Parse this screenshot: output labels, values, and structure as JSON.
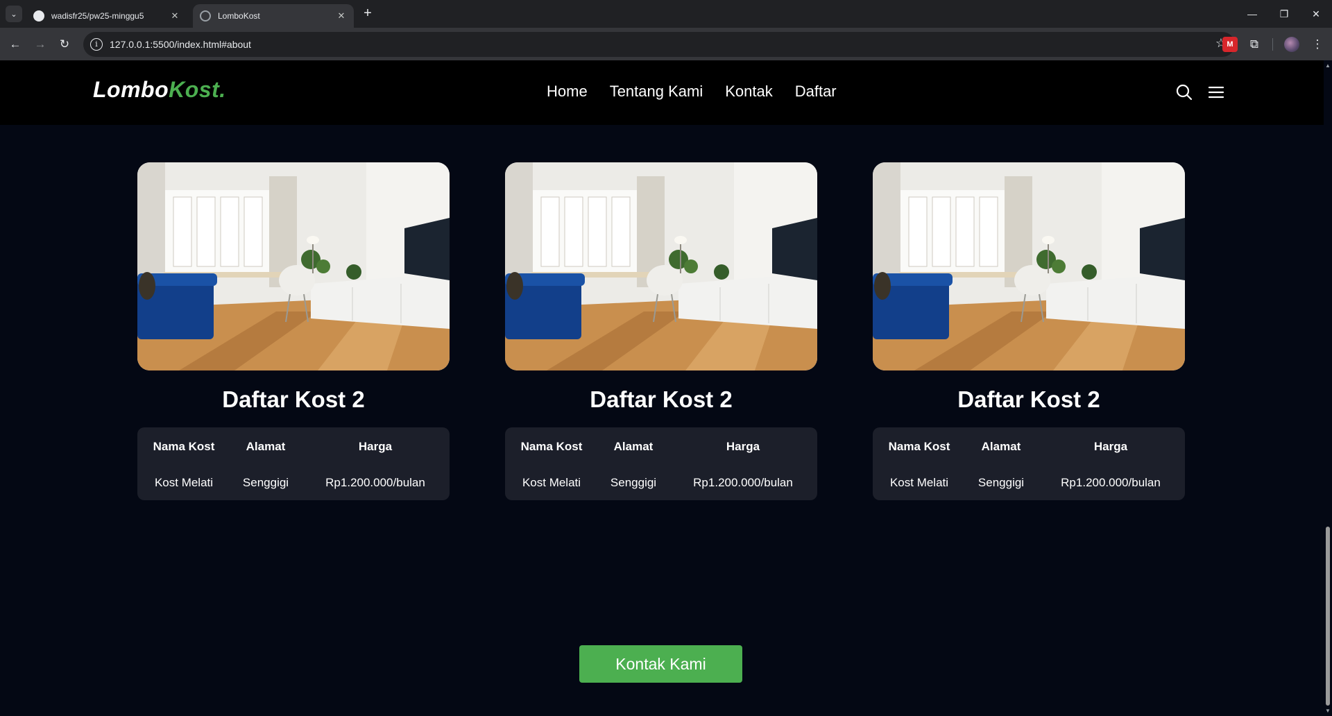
{
  "browser": {
    "tabs": [
      {
        "title": "wadisfr25/pw25-minggu5",
        "close": "✕"
      },
      {
        "title": "LomboKost",
        "close": "✕"
      }
    ],
    "new_tab": "+",
    "url": "127.0.0.1:5500/index.html#about",
    "window_controls": {
      "minimize": "—",
      "restore": "❐",
      "close": "✕"
    }
  },
  "site": {
    "logo": {
      "part1": "Lombo",
      "part2": "Kost."
    },
    "menu": [
      "Home",
      "Tentang Kami",
      "Kontak",
      "Daftar"
    ],
    "icons": [
      "search-icon",
      "hamburger-icon"
    ],
    "accent_color": "#4caf50",
    "background_color": "#040814"
  },
  "cards": [
    {
      "title": "Daftar Kost 2",
      "headers": [
        "Nama Kost",
        "Alamat",
        "Harga"
      ],
      "values": [
        "Kost Melati",
        "Senggigi",
        "Rp1.200.000/bulan"
      ]
    },
    {
      "title": "Daftar Kost 2",
      "headers": [
        "Nama Kost",
        "Alamat",
        "Harga"
      ],
      "values": [
        "Kost Melati",
        "Senggigi",
        "Rp1.200.000/bulan"
      ]
    },
    {
      "title": "Daftar Kost 2",
      "headers": [
        "Nama Kost",
        "Alamat",
        "Harga"
      ],
      "values": [
        "Kost Melati",
        "Senggigi",
        "Rp1.200.000/bulan"
      ]
    }
  ],
  "cta": {
    "label": "Kontak Kami"
  }
}
